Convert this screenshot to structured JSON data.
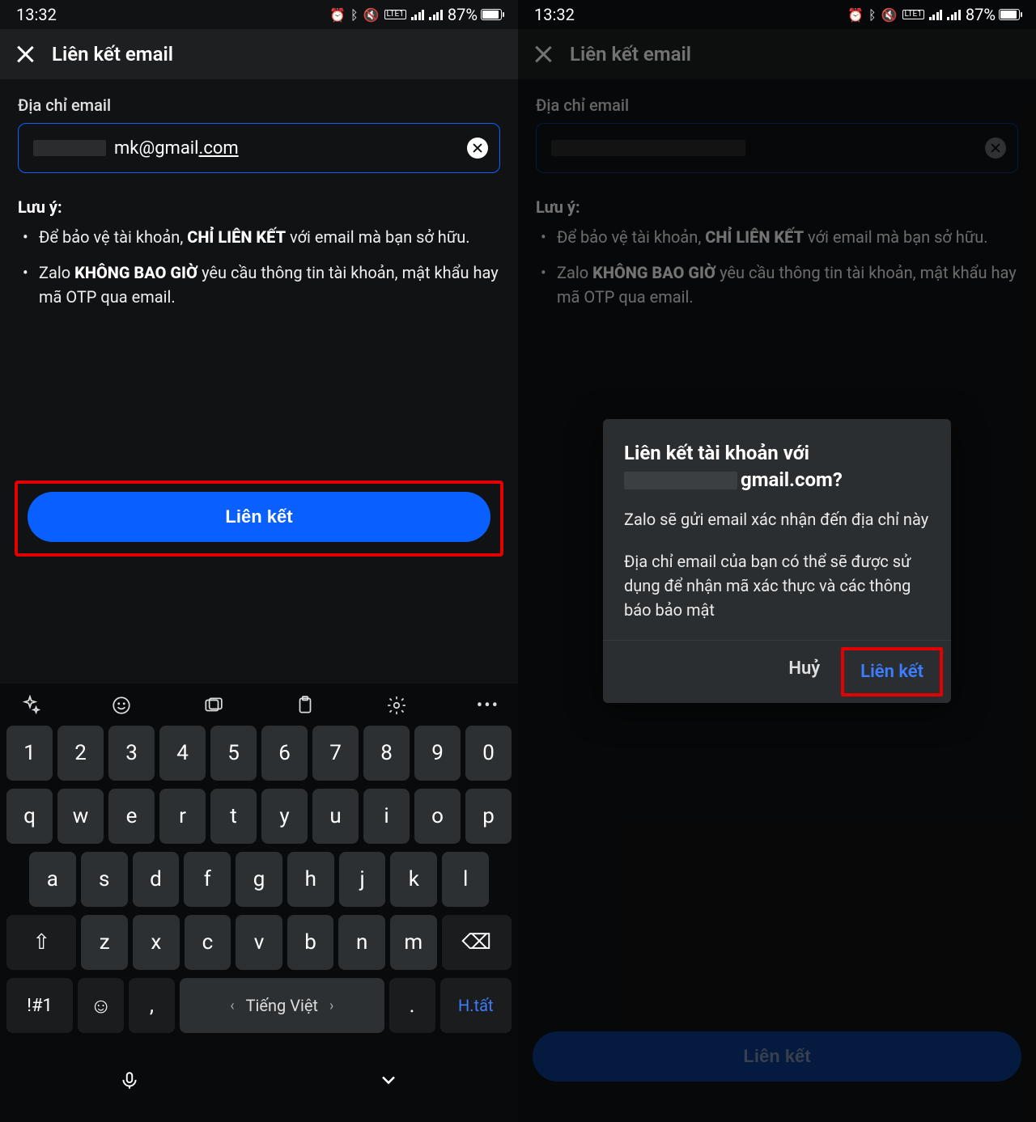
{
  "status": {
    "time": "13:32",
    "battery_pct": "87%",
    "network_label": "LTE1",
    "icons": [
      "alarm",
      "bluetooth",
      "mute",
      "volte",
      "signal",
      "signal",
      "battery"
    ]
  },
  "appbar": {
    "title": "Liên kết email"
  },
  "form": {
    "label": "Địa chỉ email",
    "email_visible_suffix": "mk@gmail",
    "email_tld": ".com"
  },
  "notes": {
    "title": "Lưu ý:",
    "item1_pre": "Để bảo vệ tài khoản, ",
    "item1_bold": "CHỈ LIÊN KẾT",
    "item1_post": " với email mà bạn sở hữu.",
    "item2_pre": "Zalo ",
    "item2_bold": "KHÔNG BAO GIỜ",
    "item2_post": " yêu cầu thông tin tài khoản, mật khẩu hay mã OTP qua email."
  },
  "primary_button": "Liên kết",
  "keyboard": {
    "row_num": [
      "1",
      "2",
      "3",
      "4",
      "5",
      "6",
      "7",
      "8",
      "9",
      "0"
    ],
    "row1": [
      "q",
      "w",
      "e",
      "r",
      "t",
      "y",
      "u",
      "i",
      "o",
      "p"
    ],
    "row2": [
      "a",
      "s",
      "d",
      "f",
      "g",
      "h",
      "j",
      "k",
      "l"
    ],
    "row3": [
      "z",
      "x",
      "c",
      "v",
      "b",
      "n",
      "m"
    ],
    "shift_icon": "⇧",
    "backspace_icon": "⌫",
    "symbol_key": "!#1",
    "emoji_key": "☺",
    "comma_key": ",",
    "period_key": ".",
    "space_label": "Tiếng Việt",
    "done_label": "H.tất",
    "mic_icon": "🎤",
    "collapse_icon": "⌄"
  },
  "dialog": {
    "title_line1": "Liên kết tài khoản với",
    "title_email_suffix": "gmail.com?",
    "para1": "Zalo sẽ gửi email xác nhận đến địa chỉ này",
    "para2": "Địa chỉ email của bạn có thể sẽ được sử dụng để nhận mã xác thực và các thông báo bảo mật",
    "cancel": "Huỷ",
    "ok": "Liên kết"
  }
}
